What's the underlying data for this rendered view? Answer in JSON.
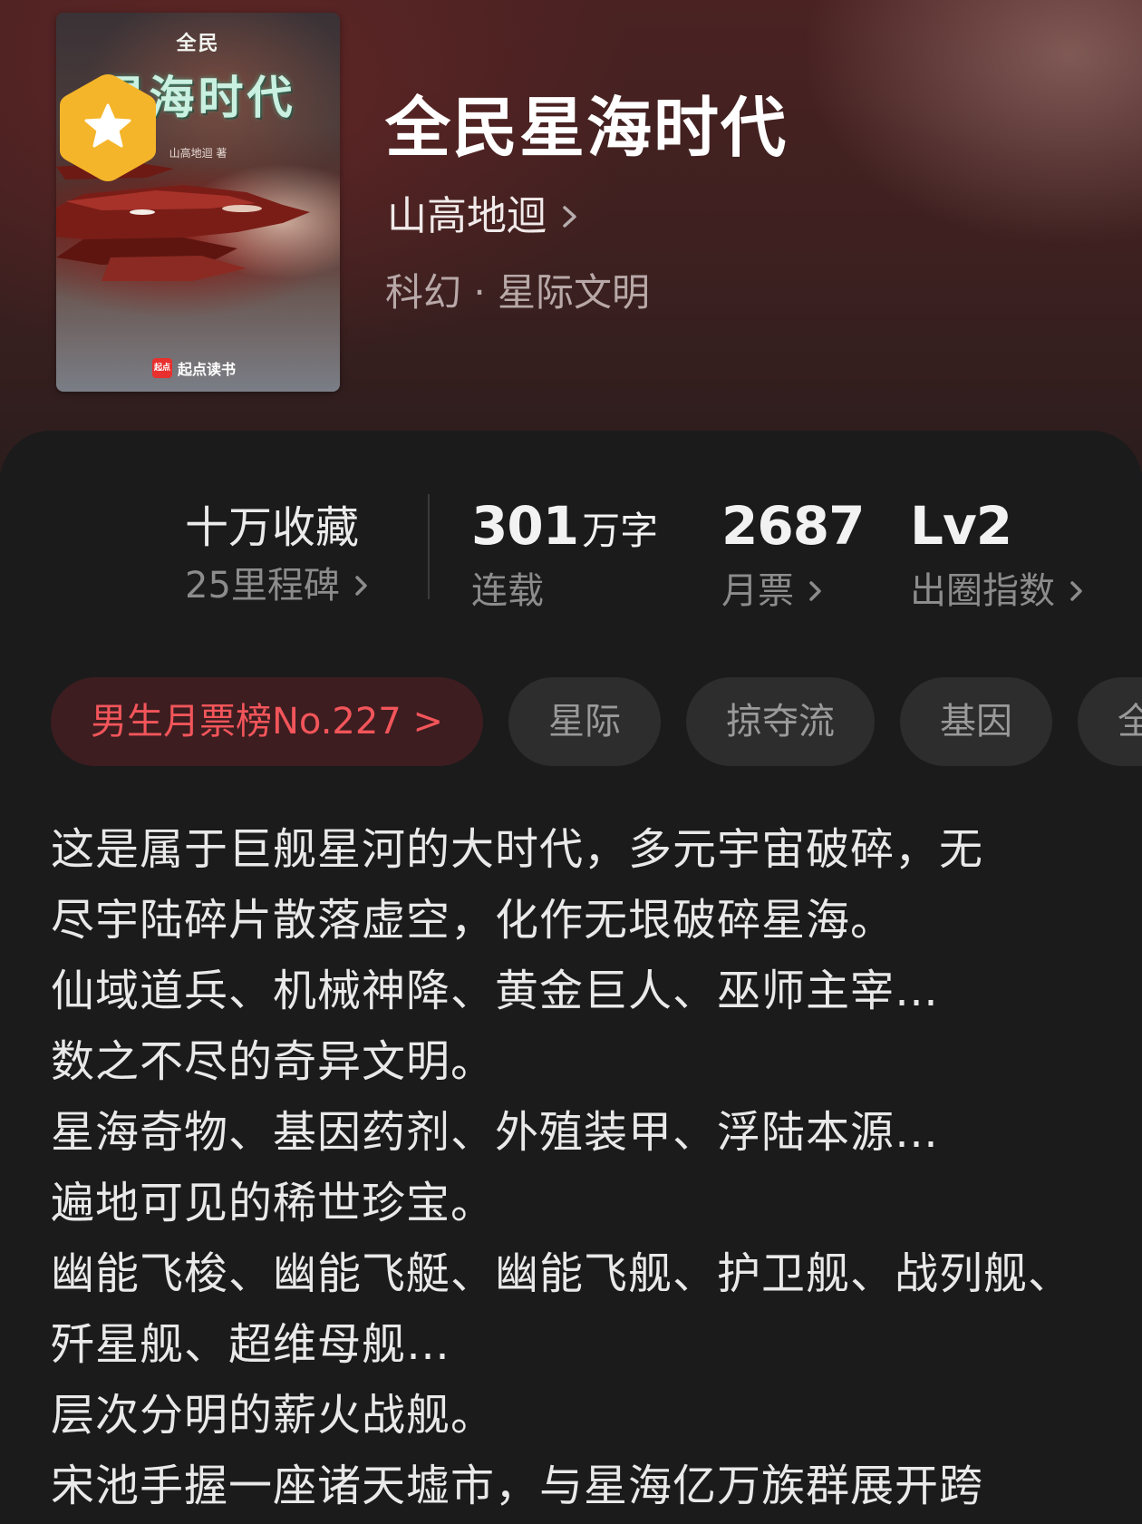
{
  "cover": {
    "top_text": "全民",
    "title_text": "星海时代",
    "author_text": "山高地迴 著",
    "brand_mark": "起点",
    "brand_text": "起点读书"
  },
  "book": {
    "title": "全民星海时代",
    "author": "山高地迴",
    "genre": "科幻 · 星际文明"
  },
  "stats": {
    "collection_title": "十万收藏",
    "collection_sub": "25里程碑",
    "word_count": "301",
    "word_unit": "万字",
    "status": "连载",
    "monthly_tickets": "2687",
    "monthly_label": "月票",
    "level": "Lv2",
    "index_label": "出圈指数"
  },
  "tags": {
    "rank": "男生月票榜No.227 >",
    "items": [
      "星际",
      "掠夺流",
      "基因",
      "全"
    ]
  },
  "synopsis": [
    "这是属于巨舰星河的大时代，多元宇宙破碎，无",
    "尽宇陆碎片散落虚空，化作无垠破碎星海。",
    "仙域道兵、机械神降、黄金巨人、巫师主宰…",
    "数之不尽的奇异文明。",
    "星海奇物、基因药剂、外殖装甲、浮陆本源…",
    "遍地可见的稀世珍宝。",
    "幽能飞梭、幽能飞艇、幽能飞舰、护卫舰、战列舰、",
    "歼星舰、超维母舰…",
    "层次分明的薪火战舰。",
    "宋池手握一座诸天墟市，与星海亿万族群展开跨"
  ],
  "colors": {
    "background": "#1b1b1c",
    "header": "#4a2222",
    "rank_text": "#f2555a",
    "rank_bg": "#3d1d20",
    "badge": "#f5b52a"
  }
}
